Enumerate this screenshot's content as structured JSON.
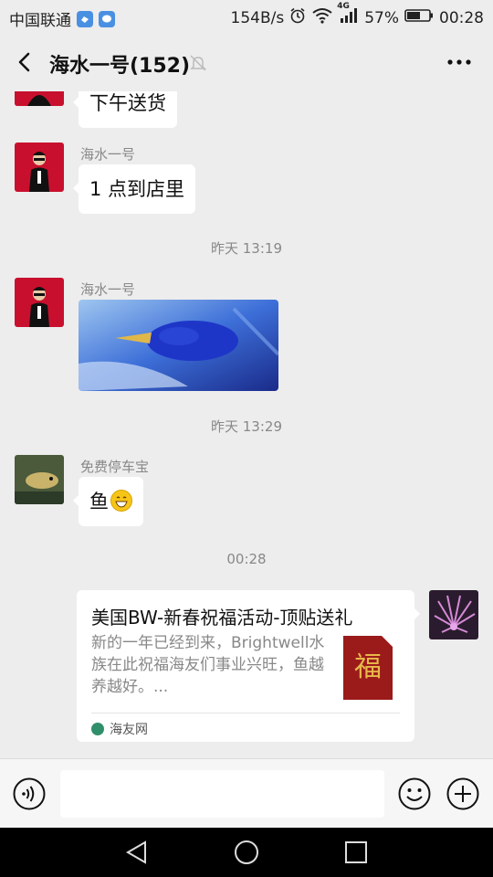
{
  "status_bar": {
    "carrier": "中国联通",
    "speed": "154B/s",
    "network": "4G",
    "battery": "57%",
    "time": "00:28"
  },
  "header": {
    "title": "海水一号(152)"
  },
  "messages": [
    {
      "sender": "",
      "text": "下午送货"
    },
    {
      "sender": "海水一号",
      "text": "1 点到店里"
    },
    {
      "timestamp": "昨天 13:19"
    },
    {
      "sender": "海水一号",
      "type": "image"
    },
    {
      "timestamp": "昨天 13:29"
    },
    {
      "sender": "免费停车宝",
      "text": "鱼"
    },
    {
      "timestamp": "00:28"
    }
  ],
  "link_card": {
    "title": "美国BW-新春祝福活动-顶贴送礼",
    "description": "新的一年已经到来，Brightwell水族在此祝福海友们事业兴旺，鱼越养越好。...",
    "thumb_char": "福",
    "source": "海友网"
  },
  "icons": {
    "back": "chevron-left-icon",
    "mute": "bell-off-icon",
    "more": "more-dots-icon",
    "voice": "voice-icon",
    "emoji": "smile-icon",
    "plus": "plus-icon"
  },
  "colors": {
    "background": "#ededed",
    "bubble": "#ffffff",
    "avatar_red": "#c8102e"
  }
}
